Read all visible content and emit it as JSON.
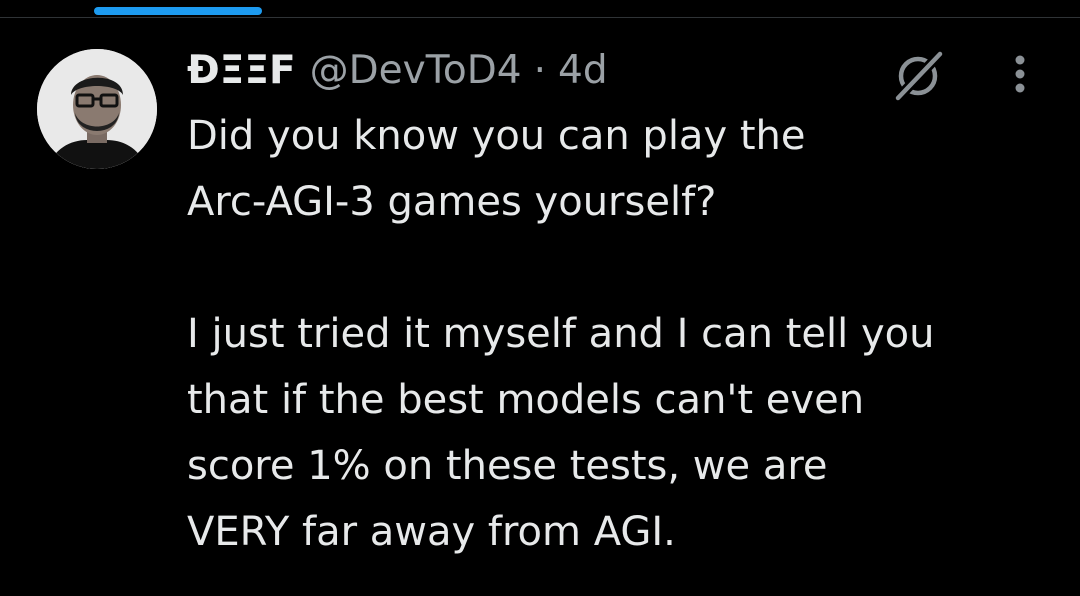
{
  "tweet": {
    "author": {
      "display_name": "ĐΞΞF",
      "handle": "@DevToD4",
      "separator": "·",
      "age": "4d",
      "avatar_icon": "profile-photo"
    },
    "paragraphs": [
      {
        "lines": [
          "Did you know you can play the",
          "Arc-AGI-3 games yourself?"
        ]
      },
      {
        "lines": [
          "I just tried it myself and I can tell you",
          "that if the best models can't even",
          "score 1% on these tests, we are",
          "VERY far away from AGI."
        ]
      }
    ],
    "icons": {
      "grok": "grok-icon",
      "more": "more-options-icon"
    }
  },
  "colors": {
    "background": "#000000",
    "text_primary": "#e7e9ea",
    "text_secondary": "#9ba1a6",
    "accent": "#1d9bf0"
  }
}
